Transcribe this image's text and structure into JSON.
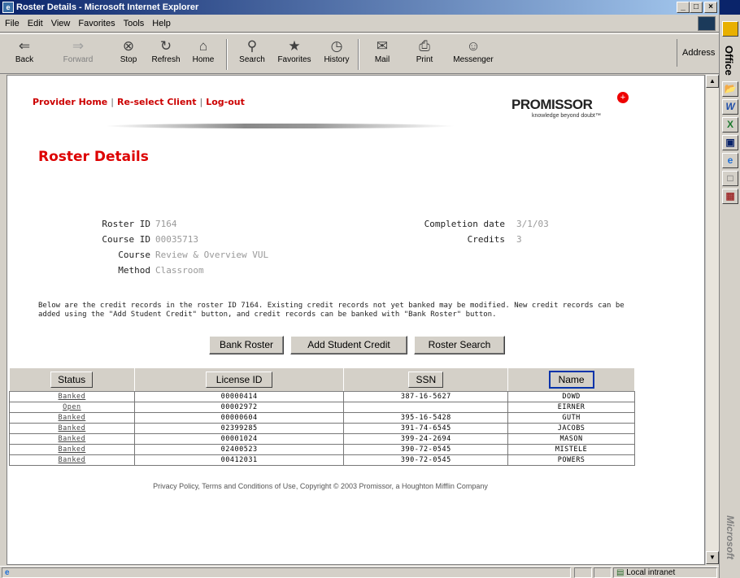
{
  "window": {
    "title": "Roster Details - Microsoft Internet Explorer",
    "min": "_",
    "max": "□",
    "close": "×"
  },
  "menu": [
    "File",
    "Edit",
    "View",
    "Favorites",
    "Tools",
    "Help"
  ],
  "toolbar": {
    "back": "Back",
    "forward": "Forward",
    "stop": "Stop",
    "refresh": "Refresh",
    "home": "Home",
    "search": "Search",
    "favorites": "Favorites",
    "history": "History",
    "mail": "Mail",
    "print": "Print",
    "messenger": "Messenger",
    "address": "Address"
  },
  "office": {
    "label": "Office",
    "brand": "Microsoft"
  },
  "nav": {
    "home": "Provider Home",
    "reselect": "Re-select Client",
    "logout": "Log-out"
  },
  "logo": {
    "brand": "PROMISSOR",
    "tagline": "knowledge beyond doubt™"
  },
  "page": {
    "title": "Roster Details"
  },
  "fields": {
    "roster_id_label": "Roster ID",
    "roster_id": "7164",
    "course_id_label": "Course ID",
    "course_id": "00035713",
    "course_label": "Course",
    "course": "Review & Overview VUL",
    "method_label": "Method",
    "method": "Classroom",
    "completion_label": "Completion date",
    "completion": "3/1/03",
    "credits_label": "Credits",
    "credits": "3"
  },
  "intro": "Below are the credit records in the roster ID 7164. Existing credit records not yet banked may be modified. New credit records can be added using the \"Add Student Credit\" button, and credit records can be banked with \"Bank Roster\" button.",
  "buttons": {
    "bank": "Bank Roster",
    "add": "Add Student Credit",
    "search": "Roster Search"
  },
  "table": {
    "headers": [
      "Status",
      "License ID",
      "SSN",
      "Name"
    ],
    "rows": [
      [
        "Banked",
        "00000414",
        "387-16-5627",
        "DOWD"
      ],
      [
        "Open",
        "00002972",
        "",
        "EIRNER"
      ],
      [
        "Banked",
        "00000604",
        "395-16-5428",
        "GUTH"
      ],
      [
        "Banked",
        "02399285",
        "391-74-6545",
        "JACOBS"
      ],
      [
        "Banked",
        "00001024",
        "399-24-2694",
        "MASON"
      ],
      [
        "Banked",
        "02400523",
        "390-72-0545",
        "MISTELE"
      ],
      [
        "Banked",
        "00412031",
        "390-72-0545",
        "POWERS"
      ]
    ]
  },
  "footer": "Privacy Policy, Terms and Conditions of Use,  Copyright © 2003 Promissor,  a Houghton Mifflin Company",
  "status": {
    "zone": "Local intranet"
  }
}
